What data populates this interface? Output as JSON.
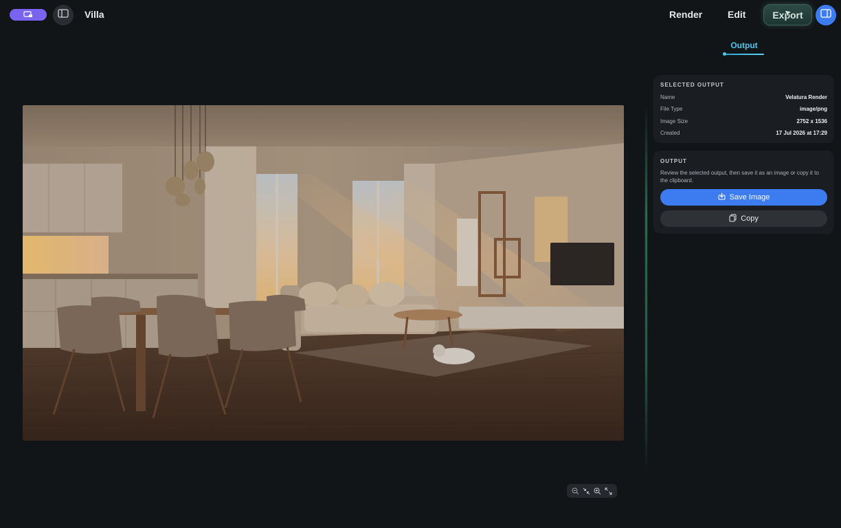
{
  "topbar": {
    "doc_title": "Villa",
    "nav": {
      "render": "Render",
      "edit": "Edit",
      "export": "Export"
    }
  },
  "sidebar": {
    "tabs": [
      {
        "label": "Output"
      }
    ],
    "selected_output": {
      "heading": "SELECTED OUTPUT",
      "rows": [
        {
          "key": "Name",
          "value": "Velatura Render"
        },
        {
          "key": "File Type",
          "value": "image/png"
        },
        {
          "key": "Image Size",
          "value": "2752 x 1536"
        },
        {
          "key": "Created",
          "value": "17 Jul 2026 at 17:29"
        }
      ]
    },
    "output": {
      "heading": "OUTPUT",
      "description": "Review the selected output, then save it as an image or copy it to the clipboard.",
      "save_label": "Save Image",
      "copy_label": "Copy"
    }
  },
  "icons": {
    "pill": "screen-share-icon",
    "sidebar_toggle": "sidebar-toggle-icon",
    "panel": "right-panel-icon",
    "save": "download-icon",
    "copy": "copy-icon",
    "zoom": [
      "zoom-out-icon",
      "fit-icon",
      "zoom-in-icon",
      "expand-icon"
    ]
  },
  "colors": {
    "accent_purple": "#7a63ee",
    "accent_blue": "#3c7bf0",
    "tab_active": "#4fc7ee",
    "export_glow": "#3f6258",
    "divider_glow": "#3cc882"
  }
}
